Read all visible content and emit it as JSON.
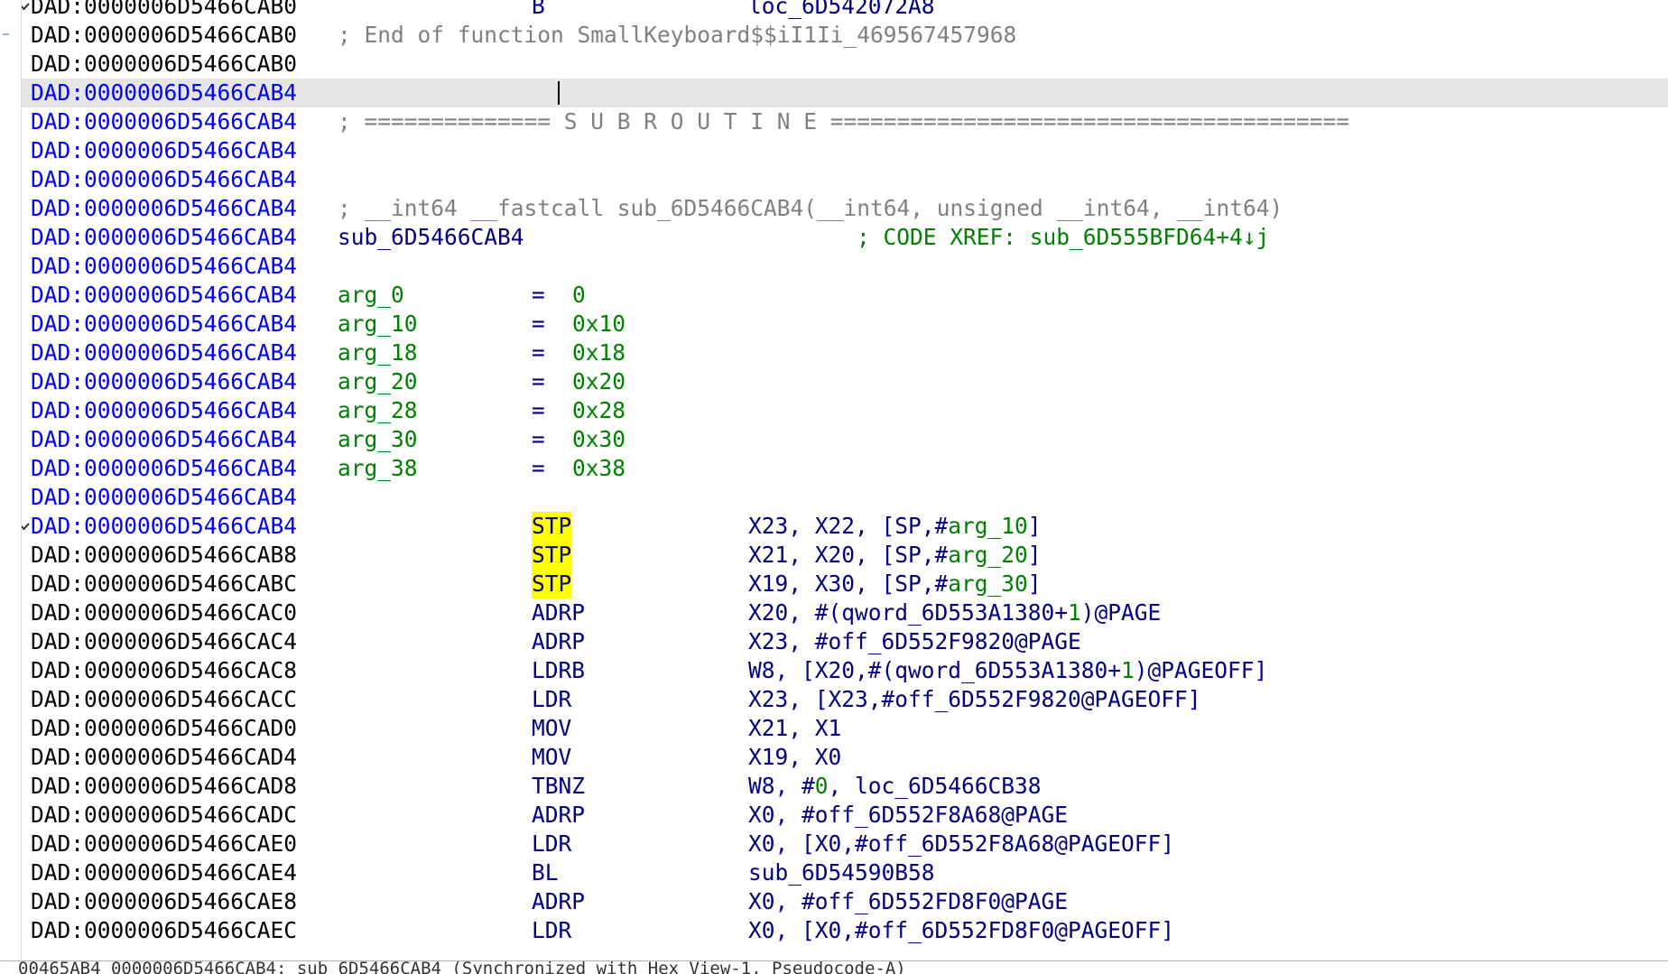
{
  "listing": {
    "rows": [
      {
        "addr": "DAD:0000006D5466CAB0",
        "mnem": "B",
        "ops": [
          {
            "t": "loc_6D542072A8"
          }
        ],
        "fold": true
      },
      {
        "addr": "DAD:0000006D5466CAB0",
        "cmt": "; End of function SmallKeyboard$$iI1Ii_469567457968"
      },
      {
        "addr": "DAD:0000006D5466CAB0"
      },
      {
        "addr": "DAD:0000006D5466CAB4",
        "blue": true,
        "current": true
      },
      {
        "addr": "DAD:0000006D5466CAB4",
        "blue": true,
        "cmt": "; ============== S U B R O U T I N E ======================================="
      },
      {
        "addr": "DAD:0000006D5466CAB4",
        "blue": true
      },
      {
        "addr": "DAD:0000006D5466CAB4",
        "blue": true
      },
      {
        "addr": "DAD:0000006D5466CAB4",
        "blue": true,
        "cmt": "; __int64 __fastcall sub_6D5466CAB4(__int64, unsigned __int64, __int64)"
      },
      {
        "addr": "DAD:0000006D5466CAB4",
        "blue": true,
        "label": "sub_6D5466CAB4",
        "xref": "; CODE XREF: sub_6D555BFD64+4↓j"
      },
      {
        "addr": "DAD:0000006D5466CAB4",
        "blue": true
      },
      {
        "addr": "DAD:0000006D5466CAB4",
        "blue": true,
        "arg": "arg_0",
        "val": "0"
      },
      {
        "addr": "DAD:0000006D5466CAB4",
        "blue": true,
        "arg": "arg_10",
        "val": "0x10"
      },
      {
        "addr": "DAD:0000006D5466CAB4",
        "blue": true,
        "arg": "arg_18",
        "val": "0x18"
      },
      {
        "addr": "DAD:0000006D5466CAB4",
        "blue": true,
        "arg": "arg_20",
        "val": "0x20"
      },
      {
        "addr": "DAD:0000006D5466CAB4",
        "blue": true,
        "arg": "arg_28",
        "val": "0x28"
      },
      {
        "addr": "DAD:0000006D5466CAB4",
        "blue": true,
        "arg": "arg_30",
        "val": "0x30"
      },
      {
        "addr": "DAD:0000006D5466CAB4",
        "blue": true,
        "arg": "arg_38",
        "val": "0x38"
      },
      {
        "addr": "DAD:0000006D5466CAB4",
        "blue": true
      },
      {
        "addr": "DAD:0000006D5466CAB4",
        "blue": true,
        "mnem": "STP",
        "hl": true,
        "fold": true,
        "arrow": true,
        "ops": [
          {
            "t": "X23, X22, [SP,#"
          },
          {
            "t": "arg_10",
            "g": true
          },
          {
            "t": "]"
          }
        ]
      },
      {
        "addr": "DAD:0000006D5466CAB8",
        "mnem": "STP",
        "hl": true,
        "dot": true,
        "ops": [
          {
            "t": "X21, X20, [SP,#"
          },
          {
            "t": "arg_20",
            "g": true
          },
          {
            "t": "]"
          }
        ]
      },
      {
        "addr": "DAD:0000006D5466CABC",
        "mnem": "STP",
        "hl": true,
        "dot": true,
        "ops": [
          {
            "t": "X19, X30, [SP,#"
          },
          {
            "t": "arg_30",
            "g": true
          },
          {
            "t": "]"
          }
        ]
      },
      {
        "addr": "DAD:0000006D5466CAC0",
        "mnem": "ADRP",
        "dot": true,
        "ops": [
          {
            "t": "X20, #(qword_6D553A1380+"
          },
          {
            "t": "1",
            "g": true
          },
          {
            "t": ")@PAGE"
          }
        ]
      },
      {
        "addr": "DAD:0000006D5466CAC4",
        "mnem": "ADRP",
        "dot": true,
        "ops": [
          {
            "t": "X23, #off_6D552F9820@PAGE"
          }
        ]
      },
      {
        "addr": "DAD:0000006D5466CAC8",
        "mnem": "LDRB",
        "dot": true,
        "ops": [
          {
            "t": "W8, [X20,#(qword_6D553A1380+"
          },
          {
            "t": "1",
            "g": true
          },
          {
            "t": ")@PAGEOFF]"
          }
        ]
      },
      {
        "addr": "DAD:0000006D5466CACC",
        "mnem": "LDR",
        "dot": true,
        "ops": [
          {
            "t": "X23, [X23,#off_6D552F9820@PAGEOFF]"
          }
        ]
      },
      {
        "addr": "DAD:0000006D5466CAD0",
        "mnem": "MOV",
        "dot": true,
        "ops": [
          {
            "t": "X21, X1"
          }
        ]
      },
      {
        "addr": "DAD:0000006D5466CAD4",
        "mnem": "MOV",
        "dot": true,
        "ops": [
          {
            "t": "X19, X0"
          }
        ]
      },
      {
        "addr": "DAD:0000006D5466CAD8",
        "mnem": "TBNZ",
        "dot": true,
        "ops": [
          {
            "t": "W8, #"
          },
          {
            "t": "0",
            "g": true
          },
          {
            "t": ", loc_6D5466CB38"
          }
        ]
      },
      {
        "addr": "DAD:0000006D5466CADC",
        "mnem": "ADRP",
        "dot": true,
        "ops": [
          {
            "t": "X0, #off_6D552F8A68@PAGE"
          }
        ]
      },
      {
        "addr": "DAD:0000006D5466CAE0",
        "mnem": "LDR",
        "dot": true,
        "ops": [
          {
            "t": "X0, [X0,#off_6D552F8A68@PAGEOFF]"
          }
        ]
      },
      {
        "addr": "DAD:0000006D5466CAE4",
        "mnem": "BL",
        "dot": true,
        "ops": [
          {
            "t": "sub_6D54590B58"
          }
        ]
      },
      {
        "addr": "DAD:0000006D5466CAE8",
        "mnem": "ADRP",
        "dot": true,
        "ops": [
          {
            "t": "X0, #off_6D552FD8F0@PAGE"
          }
        ]
      },
      {
        "addr": "DAD:0000006D5466CAEC",
        "mnem": "LDR",
        "dot": true,
        "ops": [
          {
            "t": "X0, [X0,#off_6D552FD8F0@PAGEOFF]"
          }
        ]
      }
    ]
  },
  "statusbar": {
    "text": "00465AB4 0000006D5466CAB4: sub_6D5466CAB4 (Synchronized with Hex View-1, Pseudocode-A)"
  }
}
